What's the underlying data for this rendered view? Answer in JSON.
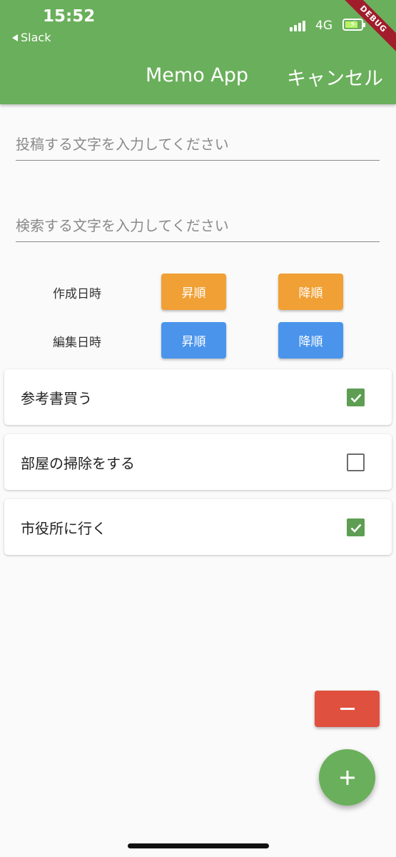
{
  "status_bar": {
    "time": "15:52",
    "back_app": "Slack",
    "network": "4G",
    "battery_level": 0.8,
    "debug_banner": "DEBUG"
  },
  "app_bar": {
    "title": "Memo App",
    "cancel_label": "キャンセル",
    "color": "#6aaf5b"
  },
  "inputs": {
    "post_placeholder": "投稿する文字を入力してください",
    "post_value": "",
    "search_placeholder": "検索する文字を入力してください",
    "search_value": ""
  },
  "sort": {
    "created": {
      "label": "作成日時",
      "asc_label": "昇順",
      "desc_label": "降順",
      "color": "#f0a035"
    },
    "edited": {
      "label": "編集日時",
      "asc_label": "昇順",
      "desc_label": "降順",
      "color": "#4a94ec"
    }
  },
  "memos": [
    {
      "text": "参考書買う",
      "checked": true
    },
    {
      "text": "部屋の掃除をする",
      "checked": false
    },
    {
      "text": "市役所に行く",
      "checked": true
    }
  ],
  "actions": {
    "remove_icon": "minus-icon",
    "remove_color": "#e0503f",
    "add_icon": "plus-icon",
    "add_color": "#6aaf5b"
  }
}
